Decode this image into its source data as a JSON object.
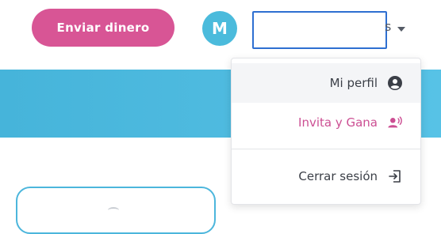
{
  "header": {
    "send_button_label": "Enviar dinero",
    "avatar_initial": "M",
    "account_name_tail": "s"
  },
  "menu": {
    "items": [
      {
        "label": "Mi perfil",
        "icon": "user-circle-icon"
      },
      {
        "label": "Invita y Gana",
        "icon": "invite-user-icon"
      },
      {
        "label": "Cerrar sesión",
        "icon": "logout-icon"
      }
    ]
  },
  "colors": {
    "brand_pink": "#d85595",
    "brand_blue": "#4bbbdc",
    "focus_outline": "#2e6fd1"
  }
}
